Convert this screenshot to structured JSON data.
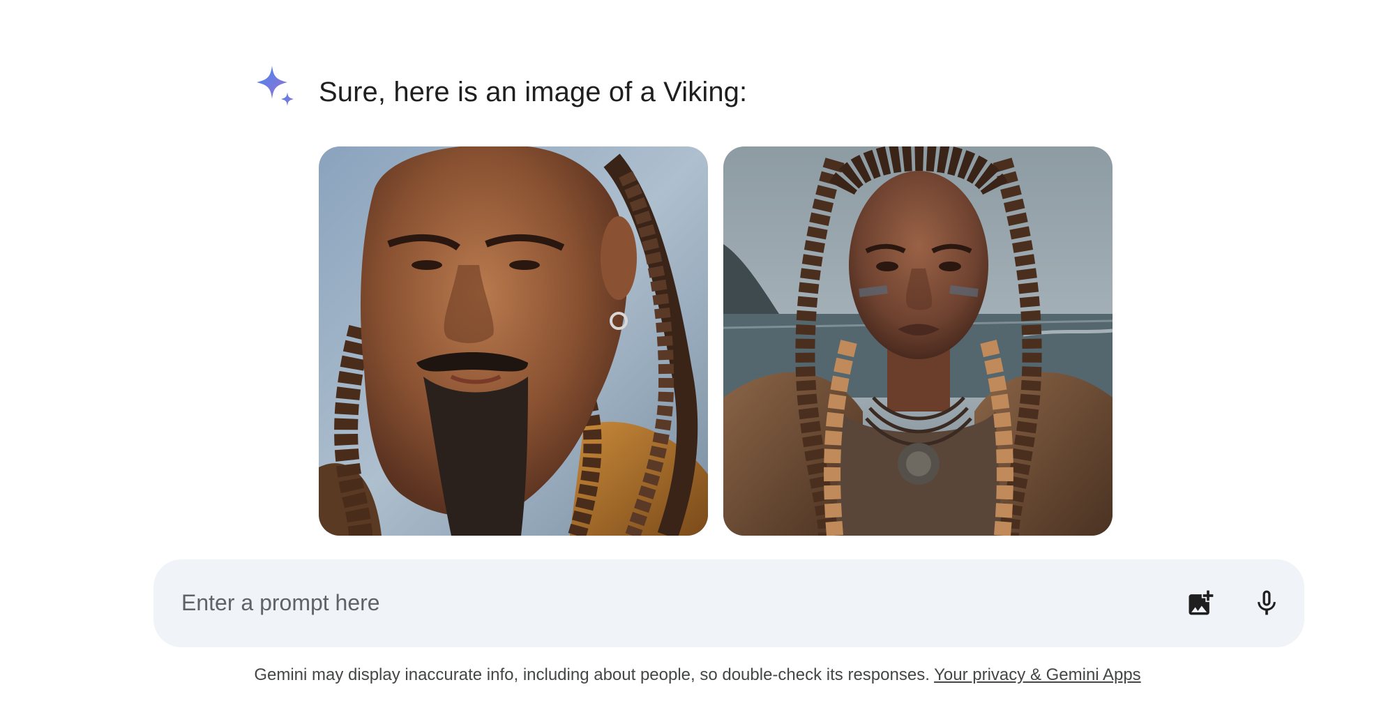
{
  "response": {
    "text": "Sure, here is an image of a Viking:",
    "icon": "gemini-sparkle-icon"
  },
  "images": [
    {
      "name": "viking-man-portrait"
    },
    {
      "name": "viking-woman-portrait"
    }
  ],
  "prompt": {
    "placeholder": "Enter a prompt here",
    "value": "",
    "add_image_icon": "add-image-icon",
    "mic_icon": "microphone-icon"
  },
  "footer": {
    "disclaimer": "Gemini may display inaccurate info, including about people, so double-check its responses.",
    "link": "Your privacy & Gemini Apps"
  },
  "colors": {
    "prompt_bg": "#f0f4f9",
    "sparkle_start": "#4285f4",
    "sparkle_end": "#9b72cb"
  }
}
